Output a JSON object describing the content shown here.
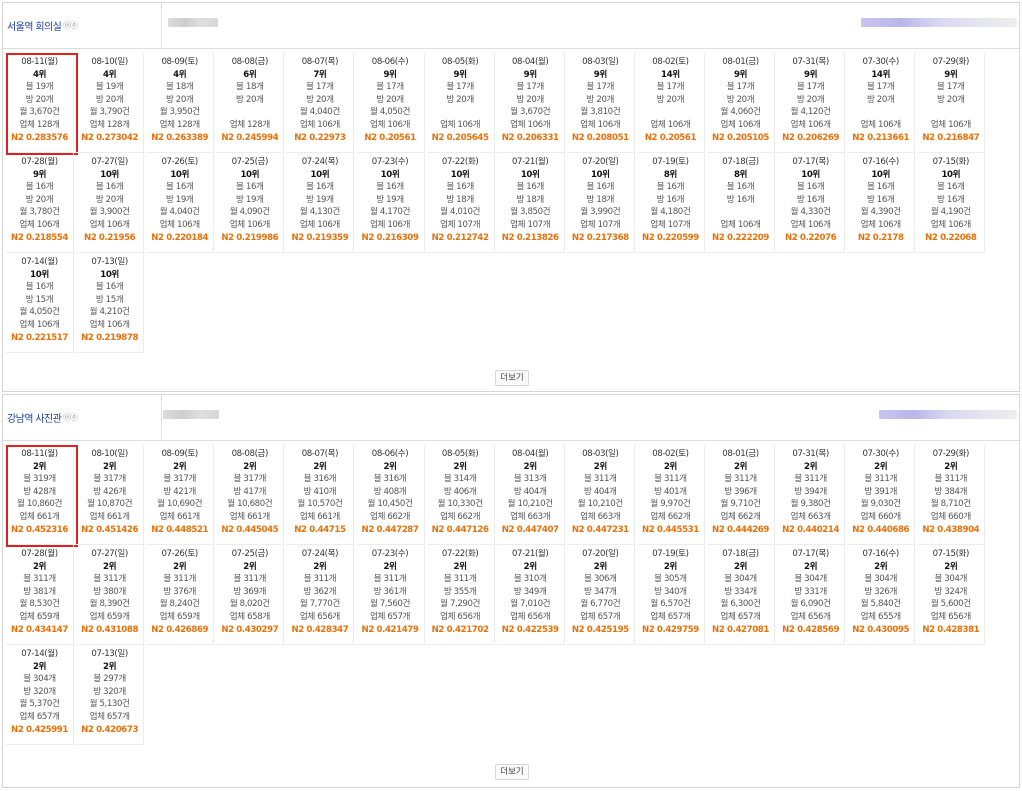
{
  "sections": [
    {
      "title": "서울역 회의실",
      "icons": "ⓜⓟ",
      "more_label": "더보기",
      "cards": [
        {
          "date": "08-11(월)",
          "rank": "4위",
          "blog": "블 19개",
          "room": "방 20개",
          "monthly": "월 3,670건",
          "vendor": "업체 128개",
          "n2": "N2 0.283576",
          "selected": true
        },
        {
          "date": "08-10(일)",
          "rank": "4위",
          "blog": "블 19개",
          "room": "방 20개",
          "monthly": "월 3,790건",
          "vendor": "업체 128개",
          "n2": "N2 0.273042"
        },
        {
          "date": "08-09(토)",
          "rank": "4위",
          "blog": "블 18개",
          "room": "방 20개",
          "monthly": "월 3,950건",
          "vendor": "업체 128개",
          "n2": "N2 0.263389"
        },
        {
          "date": "08-08(금)",
          "rank": "6위",
          "blog": "블 18개",
          "room": "방 20개",
          "monthly": "",
          "vendor": "업체 128개",
          "n2": "N2 0.245994"
        },
        {
          "date": "08-07(목)",
          "rank": "7위",
          "blog": "블 17개",
          "room": "방 20개",
          "monthly": "월 4,040건",
          "vendor": "업체 106개",
          "n2": "N2 0.22973"
        },
        {
          "date": "08-06(수)",
          "rank": "9위",
          "blog": "블 17개",
          "room": "방 20개",
          "monthly": "월 4,050건",
          "vendor": "업체 106개",
          "n2": "N2 0.20561"
        },
        {
          "date": "08-05(화)",
          "rank": "9위",
          "blog": "블 17개",
          "room": "방 20개",
          "monthly": "",
          "vendor": "업체 106개",
          "n2": "N2 0.205645"
        },
        {
          "date": "08-04(월)",
          "rank": "9위",
          "blog": "블 17개",
          "room": "방 20개",
          "monthly": "월 3,670건",
          "vendor": "업체 106개",
          "n2": "N2 0.206331"
        },
        {
          "date": "08-03(일)",
          "rank": "9위",
          "blog": "블 17개",
          "room": "방 20개",
          "monthly": "월 3,810건",
          "vendor": "업체 106개",
          "n2": "N2 0.208051"
        },
        {
          "date": "08-02(토)",
          "rank": "14위",
          "blog": "블 17개",
          "room": "방 20개",
          "monthly": "",
          "vendor": "업체 106개",
          "n2": "N2 0.20561"
        },
        {
          "date": "08-01(금)",
          "rank": "9위",
          "blog": "블 17개",
          "room": "방 20개",
          "monthly": "월 4,060건",
          "vendor": "업체 106개",
          "n2": "N2 0.205105"
        },
        {
          "date": "07-31(목)",
          "rank": "9위",
          "blog": "블 17개",
          "room": "방 20개",
          "monthly": "월 4,120건",
          "vendor": "업체 106개",
          "n2": "N2 0.206269"
        },
        {
          "date": "07-30(수)",
          "rank": "14위",
          "blog": "블 17개",
          "room": "방 20개",
          "monthly": "",
          "vendor": "업체 106개",
          "n2": "N2 0.213661"
        },
        {
          "date": "07-29(화)",
          "rank": "9위",
          "blog": "블 17개",
          "room": "방 20개",
          "monthly": "",
          "vendor": "업체 106개",
          "n2": "N2 0.216847"
        },
        {
          "date": "07-28(월)",
          "rank": "9위",
          "blog": "블 16개",
          "room": "방 20개",
          "monthly": "월 3,780건",
          "vendor": "업체 106개",
          "n2": "N2 0.218554"
        },
        {
          "date": "07-27(일)",
          "rank": "10위",
          "blog": "블 16개",
          "room": "방 20개",
          "monthly": "월 3,900건",
          "vendor": "업체 106개",
          "n2": "N2 0.21956"
        },
        {
          "date": "07-26(토)",
          "rank": "10위",
          "blog": "블 16개",
          "room": "방 19개",
          "monthly": "월 4,040건",
          "vendor": "업체 106개",
          "n2": "N2 0.220184"
        },
        {
          "date": "07-25(금)",
          "rank": "10위",
          "blog": "블 16개",
          "room": "방 19개",
          "monthly": "월 4,090건",
          "vendor": "업체 106개",
          "n2": "N2 0.219986"
        },
        {
          "date": "07-24(목)",
          "rank": "10위",
          "blog": "블 16개",
          "room": "방 19개",
          "monthly": "월 4,130건",
          "vendor": "업체 106개",
          "n2": "N2 0.219359"
        },
        {
          "date": "07-23(수)",
          "rank": "10위",
          "blog": "블 16개",
          "room": "방 19개",
          "monthly": "월 4,170건",
          "vendor": "업체 106개",
          "n2": "N2 0.216309"
        },
        {
          "date": "07-22(화)",
          "rank": "10위",
          "blog": "블 16개",
          "room": "방 18개",
          "monthly": "월 4,010건",
          "vendor": "업체 107개",
          "n2": "N2 0.212742"
        },
        {
          "date": "07-21(월)",
          "rank": "10위",
          "blog": "블 16개",
          "room": "방 18개",
          "monthly": "월 3,850건",
          "vendor": "업체 107개",
          "n2": "N2 0.213826"
        },
        {
          "date": "07-20(일)",
          "rank": "10위",
          "blog": "블 16개",
          "room": "방 18개",
          "monthly": "월 3,990건",
          "vendor": "업체 107개",
          "n2": "N2 0.217368"
        },
        {
          "date": "07-19(토)",
          "rank": "8위",
          "blog": "블 16개",
          "room": "방 16개",
          "monthly": "월 4,180건",
          "vendor": "업체 107개",
          "n2": "N2 0.220599"
        },
        {
          "date": "07-18(금)",
          "rank": "8위",
          "blog": "블 16개",
          "room": "방 16개",
          "monthly": "",
          "vendor": "업체 106개",
          "n2": "N2 0.222209"
        },
        {
          "date": "07-17(목)",
          "rank": "10위",
          "blog": "블 16개",
          "room": "방 16개",
          "monthly": "월 4,330건",
          "vendor": "업체 106개",
          "n2": "N2 0.22076"
        },
        {
          "date": "07-16(수)",
          "rank": "10위",
          "blog": "블 16개",
          "room": "방 16개",
          "monthly": "월 4,390건",
          "vendor": "업체 106개",
          "n2": "N2 0.2178"
        },
        {
          "date": "07-15(화)",
          "rank": "10위",
          "blog": "블 16개",
          "room": "방 16개",
          "monthly": "월 4,190건",
          "vendor": "업체 106개",
          "n2": "N2 0.22068"
        },
        {
          "date": "07-14(월)",
          "rank": "10위",
          "blog": "블 16개",
          "room": "방 15개",
          "monthly": "월 4,050건",
          "vendor": "업체 106개",
          "n2": "N2 0.221517"
        },
        {
          "date": "07-13(일)",
          "rank": "10위",
          "blog": "블 16개",
          "room": "방 15개",
          "monthly": "월 4,210건",
          "vendor": "업체 106개",
          "n2": "N2 0.219878"
        }
      ]
    },
    {
      "title": "강남역 사진관",
      "icons": "ⓜⓟ",
      "more_label": "더보기",
      "cards": [
        {
          "date": "08-11(월)",
          "rank": "2위",
          "blog": "블 319개",
          "room": "방 428개",
          "monthly": "월 10,860건",
          "vendor": "업체 661개",
          "n2": "N2 0.452316",
          "selected": true
        },
        {
          "date": "08-10(일)",
          "rank": "2위",
          "blog": "블 317개",
          "room": "방 426개",
          "monthly": "월 10,870건",
          "vendor": "업체 661개",
          "n2": "N2 0.451426"
        },
        {
          "date": "08-09(토)",
          "rank": "2위",
          "blog": "블 317개",
          "room": "방 421개",
          "monthly": "월 10,690건",
          "vendor": "업체 661개",
          "n2": "N2 0.448521"
        },
        {
          "date": "08-08(금)",
          "rank": "2위",
          "blog": "블 317개",
          "room": "방 417개",
          "monthly": "월 10,680건",
          "vendor": "업체 661개",
          "n2": "N2 0.445045"
        },
        {
          "date": "08-07(목)",
          "rank": "2위",
          "blog": "블 316개",
          "room": "방 410개",
          "monthly": "월 10,570건",
          "vendor": "업체 661개",
          "n2": "N2 0.44715"
        },
        {
          "date": "08-06(수)",
          "rank": "2위",
          "blog": "블 316개",
          "room": "방 408개",
          "monthly": "월 10,450건",
          "vendor": "업체 662개",
          "n2": "N2 0.447287"
        },
        {
          "date": "08-05(화)",
          "rank": "2위",
          "blog": "블 314개",
          "room": "방 406개",
          "monthly": "월 10,330건",
          "vendor": "업체 662개",
          "n2": "N2 0.447126"
        },
        {
          "date": "08-04(월)",
          "rank": "2위",
          "blog": "블 313개",
          "room": "방 404개",
          "monthly": "월 10,210건",
          "vendor": "업체 663개",
          "n2": "N2 0.447407"
        },
        {
          "date": "08-03(일)",
          "rank": "2위",
          "blog": "블 311개",
          "room": "방 404개",
          "monthly": "월 10,210건",
          "vendor": "업체 663개",
          "n2": "N2 0.447231"
        },
        {
          "date": "08-02(토)",
          "rank": "2위",
          "blog": "블 311개",
          "room": "방 401개",
          "monthly": "월 9,970건",
          "vendor": "업체 662개",
          "n2": "N2 0.445531"
        },
        {
          "date": "08-01(금)",
          "rank": "2위",
          "blog": "블 311개",
          "room": "방 396개",
          "monthly": "월 9,710건",
          "vendor": "업체 662개",
          "n2": "N2 0.444269"
        },
        {
          "date": "07-31(목)",
          "rank": "2위",
          "blog": "블 311개",
          "room": "방 394개",
          "monthly": "월 9,380건",
          "vendor": "업체 663개",
          "n2": "N2 0.440214"
        },
        {
          "date": "07-30(수)",
          "rank": "2위",
          "blog": "블 311개",
          "room": "방 391개",
          "monthly": "월 9,030건",
          "vendor": "업체 660개",
          "n2": "N2 0.440686"
        },
        {
          "date": "07-29(화)",
          "rank": "2위",
          "blog": "블 311개",
          "room": "방 384개",
          "monthly": "월 8,710건",
          "vendor": "업체 660개",
          "n2": "N2 0.438904"
        },
        {
          "date": "07-28(월)",
          "rank": "2위",
          "blog": "블 311개",
          "room": "방 381개",
          "monthly": "월 8,530건",
          "vendor": "업체 659개",
          "n2": "N2 0.434147"
        },
        {
          "date": "07-27(일)",
          "rank": "2위",
          "blog": "블 311개",
          "room": "방 380개",
          "monthly": "월 8,390건",
          "vendor": "업체 659개",
          "n2": "N2 0.431088"
        },
        {
          "date": "07-26(토)",
          "rank": "2위",
          "blog": "블 311개",
          "room": "방 376개",
          "monthly": "월 8,240건",
          "vendor": "업체 659개",
          "n2": "N2 0.426869"
        },
        {
          "date": "07-25(금)",
          "rank": "2위",
          "blog": "블 311개",
          "room": "방 369개",
          "monthly": "월 8,020건",
          "vendor": "업체 658개",
          "n2": "N2 0.430297"
        },
        {
          "date": "07-24(목)",
          "rank": "2위",
          "blog": "블 311개",
          "room": "방 362개",
          "monthly": "월 7,770건",
          "vendor": "업체 656개",
          "n2": "N2 0.428347"
        },
        {
          "date": "07-23(수)",
          "rank": "2위",
          "blog": "블 311개",
          "room": "방 361개",
          "monthly": "월 7,560건",
          "vendor": "업체 657개",
          "n2": "N2 0.421479"
        },
        {
          "date": "07-22(화)",
          "rank": "2위",
          "blog": "블 311개",
          "room": "방 355개",
          "monthly": "월 7,290건",
          "vendor": "업체 656개",
          "n2": "N2 0.421702"
        },
        {
          "date": "07-21(월)",
          "rank": "2위",
          "blog": "블 310개",
          "room": "방 349개",
          "monthly": "월 7,010건",
          "vendor": "업체 656개",
          "n2": "N2 0.422539"
        },
        {
          "date": "07-20(일)",
          "rank": "2위",
          "blog": "블 306개",
          "room": "방 347개",
          "monthly": "월 6,770건",
          "vendor": "업체 657개",
          "n2": "N2 0.425195"
        },
        {
          "date": "07-19(토)",
          "rank": "2위",
          "blog": "블 305개",
          "room": "방 340개",
          "monthly": "월 6,570건",
          "vendor": "업체 657개",
          "n2": "N2 0.429759"
        },
        {
          "date": "07-18(금)",
          "rank": "2위",
          "blog": "블 304개",
          "room": "방 334개",
          "monthly": "월 6,300건",
          "vendor": "업체 657개",
          "n2": "N2 0.427081"
        },
        {
          "date": "07-17(목)",
          "rank": "2위",
          "blog": "블 304개",
          "room": "방 331개",
          "monthly": "월 6,090건",
          "vendor": "업체 656개",
          "n2": "N2 0.428569"
        },
        {
          "date": "07-16(수)",
          "rank": "2위",
          "blog": "블 304개",
          "room": "방 326개",
          "monthly": "월 5,840건",
          "vendor": "업체 655개",
          "n2": "N2 0.430095"
        },
        {
          "date": "07-15(화)",
          "rank": "2위",
          "blog": "블 304개",
          "room": "방 324개",
          "monthly": "월 5,600건",
          "vendor": "업체 656개",
          "n2": "N2 0.428381"
        },
        {
          "date": "07-14(월)",
          "rank": "2위",
          "blog": "블 304개",
          "room": "방 320개",
          "monthly": "월 5,370건",
          "vendor": "업체 657개",
          "n2": "N2 0.425991"
        },
        {
          "date": "07-13(일)",
          "rank": "2위",
          "blog": "블 297개",
          "room": "방 320개",
          "monthly": "월 5,130건",
          "vendor": "업체 657개",
          "n2": "N2 0.420673"
        }
      ]
    }
  ]
}
